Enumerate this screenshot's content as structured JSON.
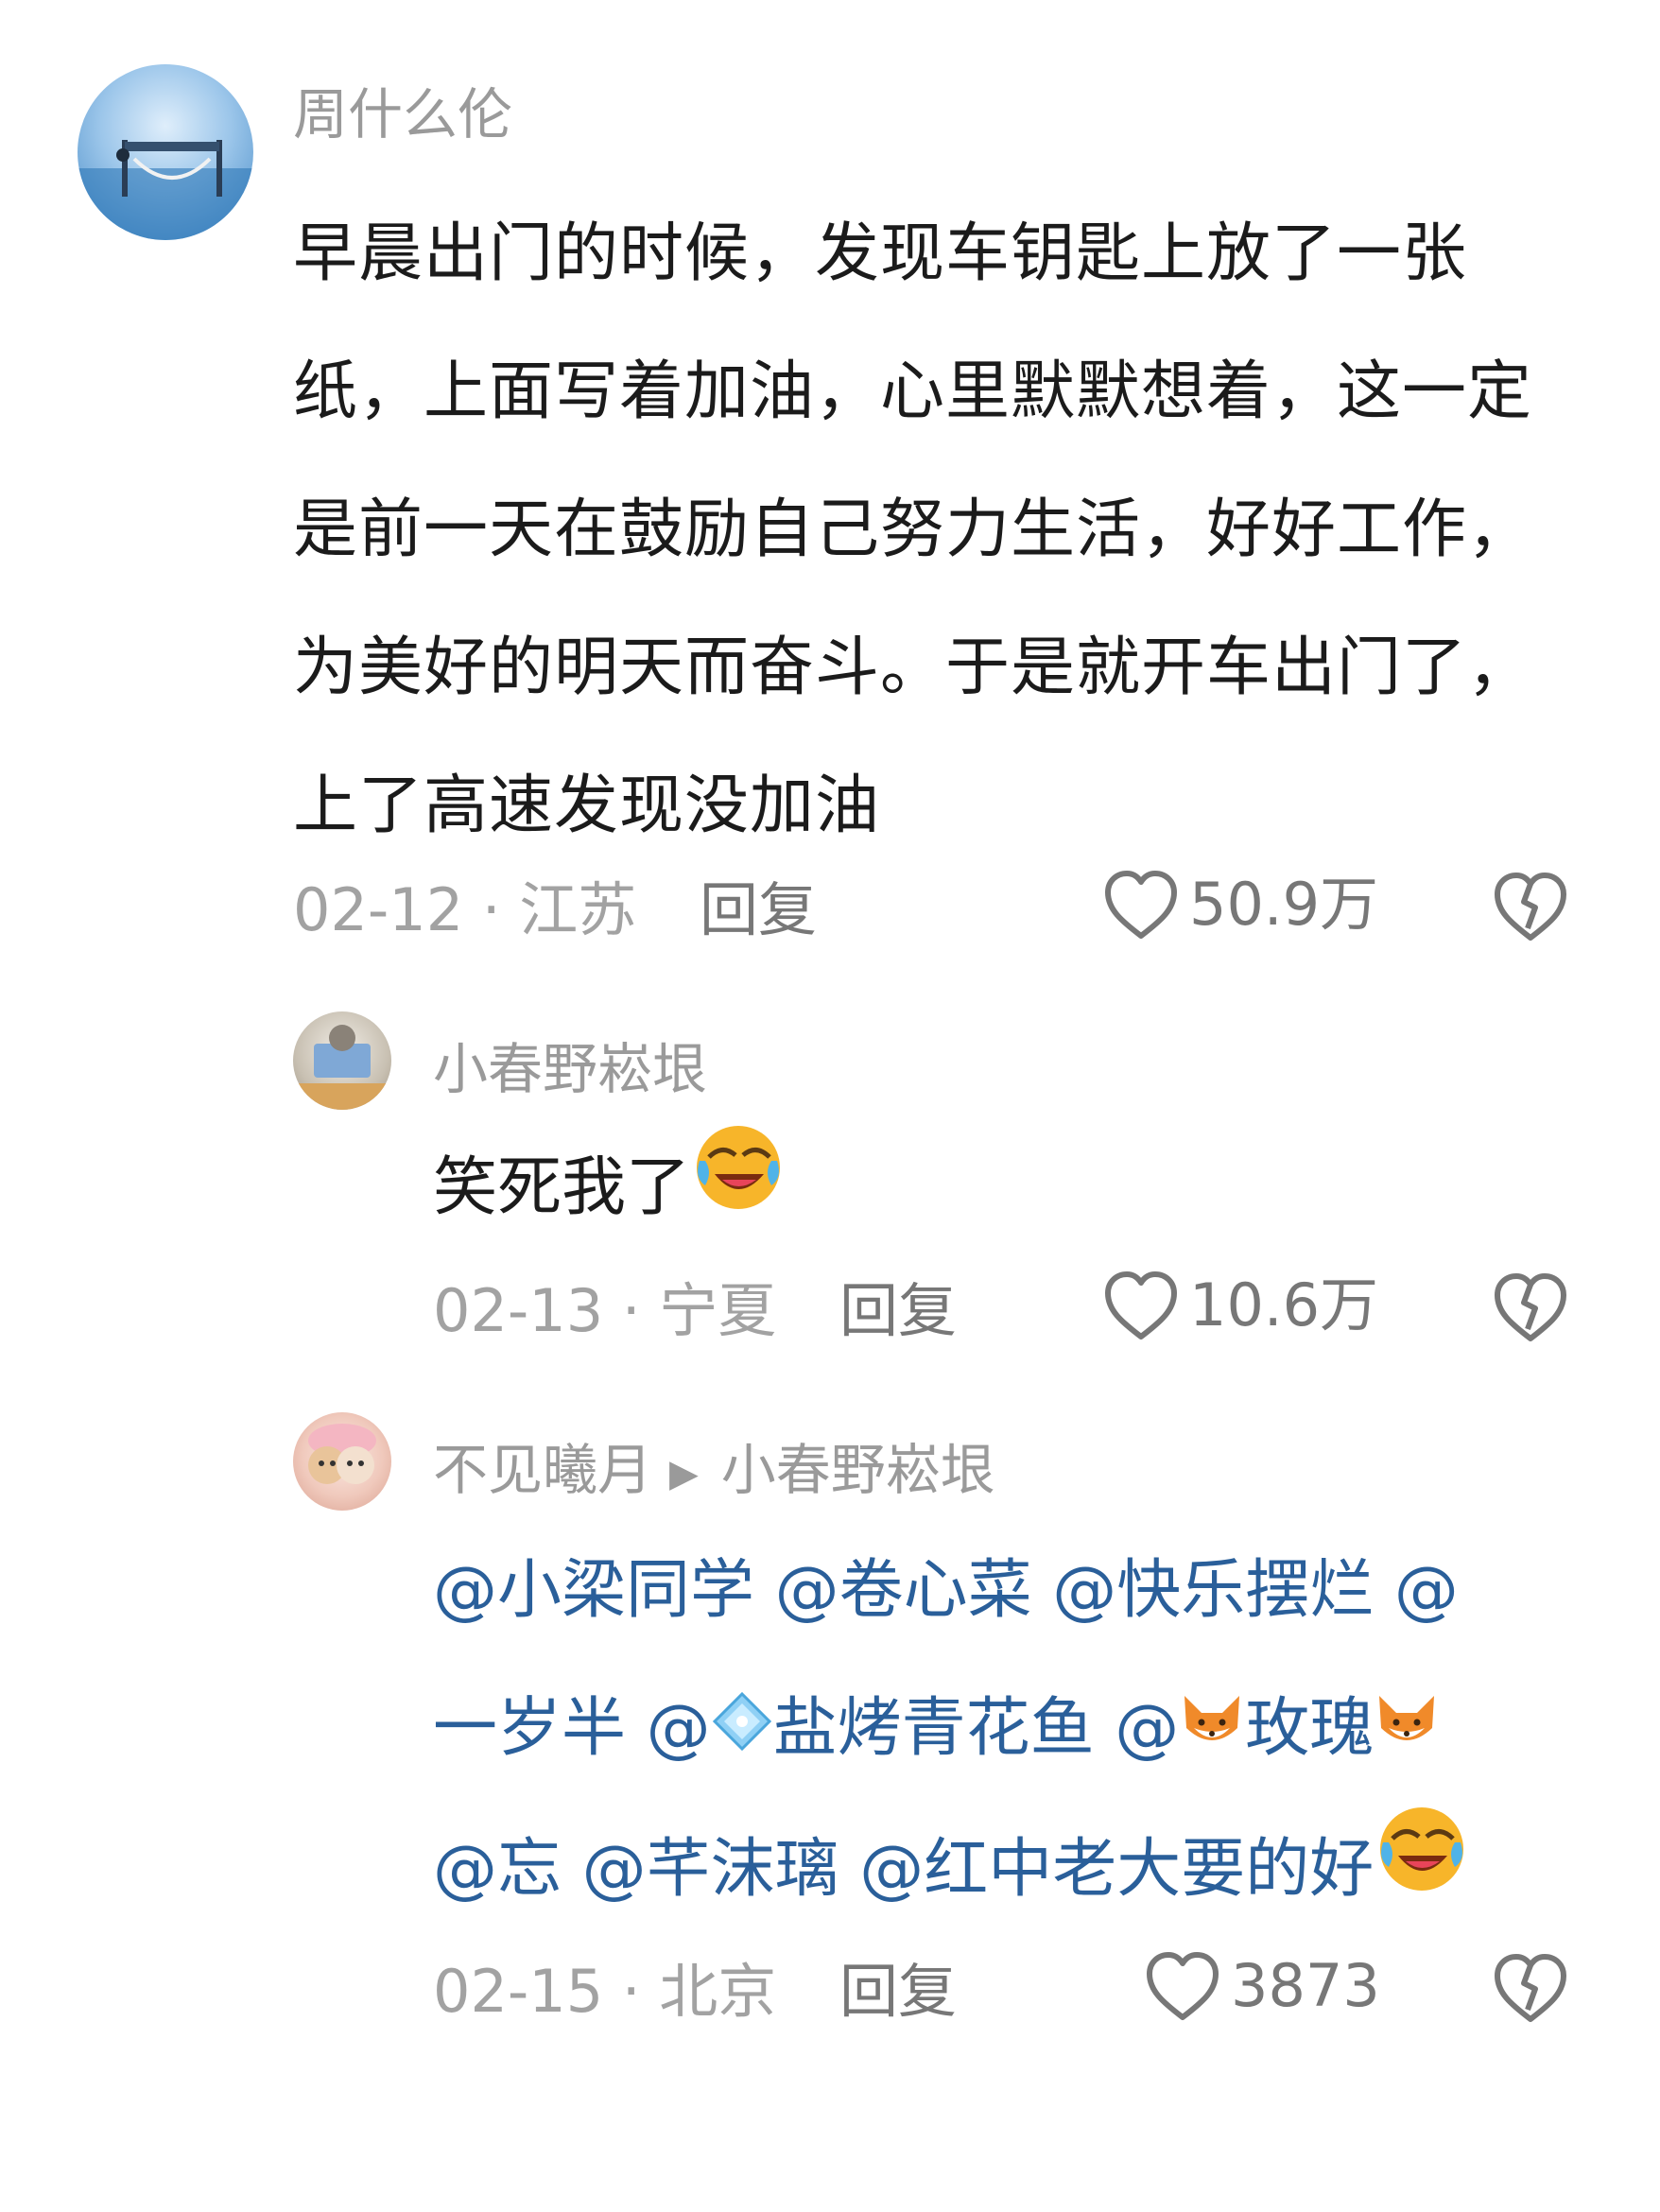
{
  "main_comment": {
    "username": "周什么伦",
    "text": "早晨出门的时候，发现车钥匙上放了一张纸，上面写着加油，心里默默想着，这一定是前一天在鼓励自己努力生活，好好工作，为美好的明天而奋斗。于是就开车出门了，上了高速发现没加油",
    "meta": "02-12 · 江苏",
    "reply_label": "回复",
    "likes": "50.9万"
  },
  "reply1": {
    "username": "小春野崧垠",
    "text": "笑死我了",
    "meta": "02-13 · 宁夏",
    "reply_label": "回复",
    "likes": "10.6万"
  },
  "reply2": {
    "username": "不见曦月",
    "reply_to": "小春野崧垠",
    "line1": [
      "@小梁同学",
      "@卷心菜",
      "@快乐摆烂",
      "@"
    ],
    "line2_a": "一岁半",
    "line2_b": "@",
    "line2_c": "盐烤青花鱼",
    "line2_d": "@",
    "line2_e": "玫瑰",
    "line3": [
      "@忘",
      "@芊沫璃",
      "@红中老大要的好"
    ],
    "meta": "02-15 · 北京",
    "reply_label": "回复",
    "likes": "3873"
  },
  "colors": {
    "mention": "#2a5f9a",
    "meta": "#a2a2a2",
    "username": "#9a9a9a",
    "text": "#1b1b1b"
  }
}
